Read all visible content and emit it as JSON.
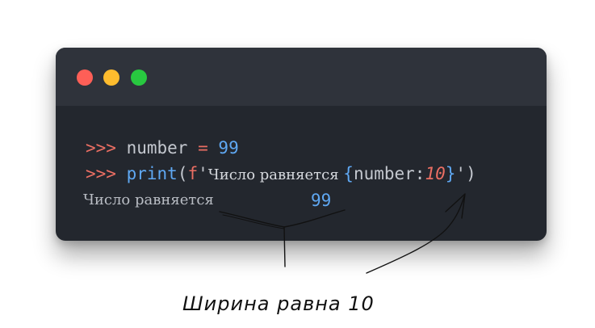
{
  "window": {
    "controls": [
      "close",
      "minimize",
      "maximize"
    ]
  },
  "code": {
    "line1": {
      "prompt": ">>>",
      "var": "number",
      "op": "=",
      "value": "99"
    },
    "line2": {
      "prompt": ">>>",
      "fn": "print",
      "open": "(",
      "fprefix": "f",
      "quote_open": "'",
      "text": "Число равняется ",
      "brace_open": "{",
      "field": "number",
      "colon": ":",
      "format": "10",
      "brace_close": "}",
      "quote_close": "'",
      "close": ")"
    },
    "output": {
      "text": "Число равняется",
      "value": "99"
    }
  },
  "annotation": {
    "caption": "Ширина равна 10"
  }
}
